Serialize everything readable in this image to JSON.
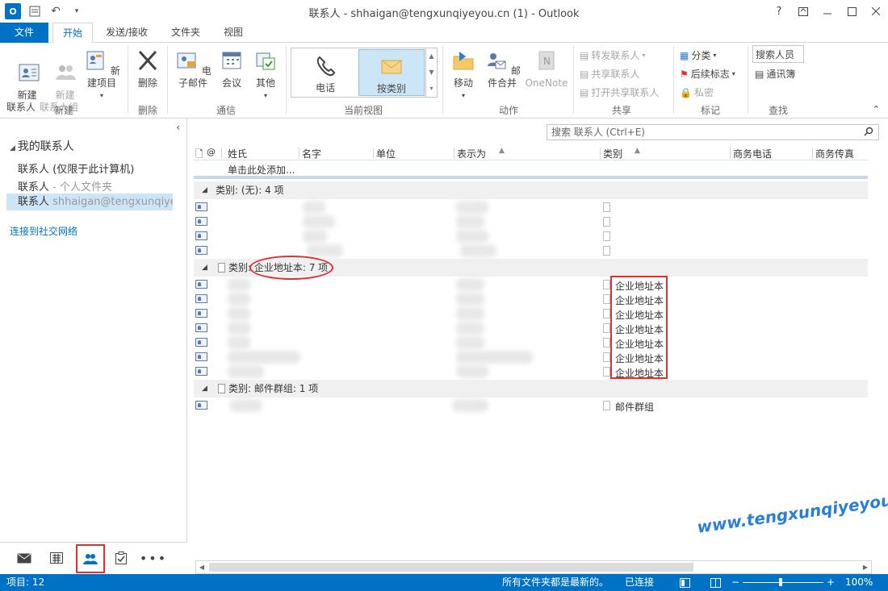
{
  "window": {
    "title": "联系人 - shhaigan@tengxunqiyeyou.cn (1) - Outlook",
    "help": "?",
    "logo": "O"
  },
  "tabs": [
    {
      "label": "文件"
    },
    {
      "label": "开始"
    },
    {
      "label": "发送/接收"
    },
    {
      "label": "文件夹"
    },
    {
      "label": "视图"
    }
  ],
  "ribbon": {
    "new_contact": "新建\n联系人",
    "new_group": "新建\n联系人组",
    "new_items": "新建项目",
    "delete": "删除",
    "email": "电子邮件",
    "meeting": "会议",
    "other": "其他",
    "phone": "电话",
    "by_category": "按类别",
    "move": "移动",
    "mail_merge": "邮件合并",
    "onenote": "OneNote",
    "forward_contact": "转发联系人",
    "share_contacts": "共享联系人",
    "open_shared": "打开共享联系人",
    "categorize": "分类",
    "follow_up": "后续标志",
    "private": "私密",
    "search_people": "搜索人员",
    "address_book": "通讯簿",
    "groups": {
      "new": "新建",
      "delete": "删除",
      "comm": "通信",
      "view": "当前视图",
      "actions": "动作",
      "share": "共享",
      "tags": "标记",
      "find": "查找"
    }
  },
  "nav": {
    "my_contacts": "我的联系人",
    "items": [
      {
        "label": "联系人 (仅限于此计算机)",
        "sub": ""
      },
      {
        "label": "联系人",
        "sub": " - 个人文件夹"
      },
      {
        "label": "联系人",
        "sub": " shhaigan@tengxunqiye..."
      }
    ],
    "connect": "连接到社交网络"
  },
  "search": {
    "placeholder": "搜索 联系人 (Ctrl+E)"
  },
  "columns": [
    "姓氏",
    "名字",
    "单位",
    "表示为",
    "类别",
    "商务电话",
    "商务传真"
  ],
  "add_row": "单击此处添加...",
  "groups": [
    {
      "label": "类别: (无): 4 项",
      "rows": 4,
      "category": ""
    },
    {
      "label": "类别: 企业地址本: 7 项",
      "rows": 7,
      "category": "企业地址本"
    },
    {
      "label": "类别: 邮件群组: 1 项",
      "rows": 1,
      "category": "邮件群组"
    }
  ],
  "status": {
    "items": "项目: 12",
    "uptodate": "所有文件夹都是最新的。",
    "connected": "已连接",
    "zoom": "100%"
  },
  "watermark": "www.tengxunqiyeyou.com",
  "colors": {
    "accent": "#0072c6",
    "highlight": "#e03030",
    "selection": "#cde6f7"
  }
}
